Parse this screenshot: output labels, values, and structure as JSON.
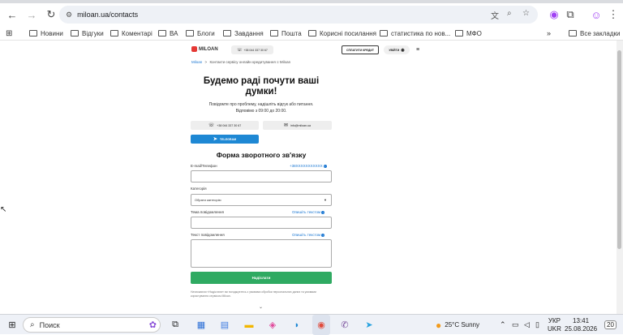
{
  "browser": {
    "url": "miloan.ua/contacts",
    "bookmarks": [
      "Новини",
      "Відгуки",
      "Коментарі",
      "ВА",
      "Блоги",
      "Завдання",
      "Пошта",
      "Корисні посилання",
      "статистика по нов...",
      "МФО"
    ],
    "all_bookmarks": "Все закладки",
    "more_bookmarks": "»"
  },
  "site": {
    "logo": "MILOAN",
    "phone_pill": "+38 044 337 30 67",
    "credit_button": "СПЛАТИТИ КРЕДИТ",
    "login_button": "УВІЙТИ",
    "breadcrumb_home": "Miloan",
    "breadcrumb_sep": ">",
    "breadcrumb_current": "Контакти сервісу онлайн кредитування ≡ Miloan",
    "title": "Будемо раді почути ваші думки!",
    "subtitle_line1": "Повідомте про проблему, надішліть відгук або питання.",
    "subtitle_line2": "Відповімо з 09:00 до 20:00.",
    "phone_button": "+38 044 337 30 67",
    "email_button": "info@miloan.ua",
    "telegram_button": "TELEGRAM",
    "form_title": "Форма зворотного зв'язку",
    "email_label": "E-mail/Телефон",
    "email_hint": "+38XXXXXXXXXXX",
    "category_label": "Категорія",
    "category_value": "Обрати категорію",
    "subject_label": "Тема повідомлення",
    "subject_hint": "Опишіть текстом",
    "message_label": "Текст повідомлення",
    "message_hint": "Опишіть текстом",
    "submit": "Надіслати",
    "fine_print": "Натискаючи «Надіслати» ви погоджуєтесь з умовами обробки персональних даних та умовами користування сервісом Miloan."
  },
  "taskbar": {
    "search": "Поиск",
    "weather": "25°C  Sunny",
    "lang_top": "УКР",
    "lang_bottom": "UKR",
    "time": "13:41",
    "date": "25.08.2026",
    "notif": "20"
  }
}
